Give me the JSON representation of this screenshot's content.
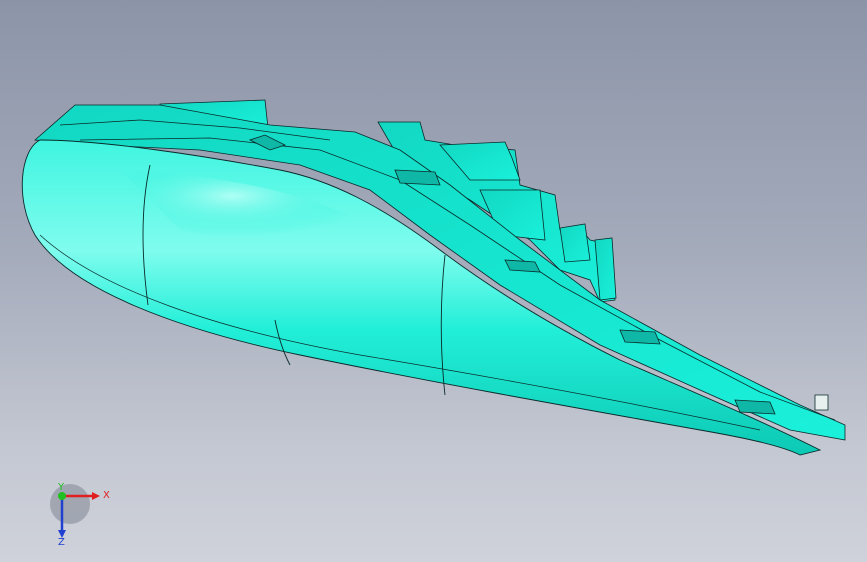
{
  "viewport": {
    "background_top": "#8c94a8",
    "background_bottom": "#cfd2da"
  },
  "model": {
    "icon": "cad-part-headlamp-housing",
    "fill_color": "#18f0d8",
    "shade_color": "#0cc9b4",
    "highlight_color": "#7ffcee",
    "edge_color": "#0a2a2a"
  },
  "triad": {
    "x_label": "X",
    "y_label": "Y",
    "z_label": "Z",
    "x_color": "#e02020",
    "y_color": "#20c020",
    "z_color": "#2040d0"
  }
}
